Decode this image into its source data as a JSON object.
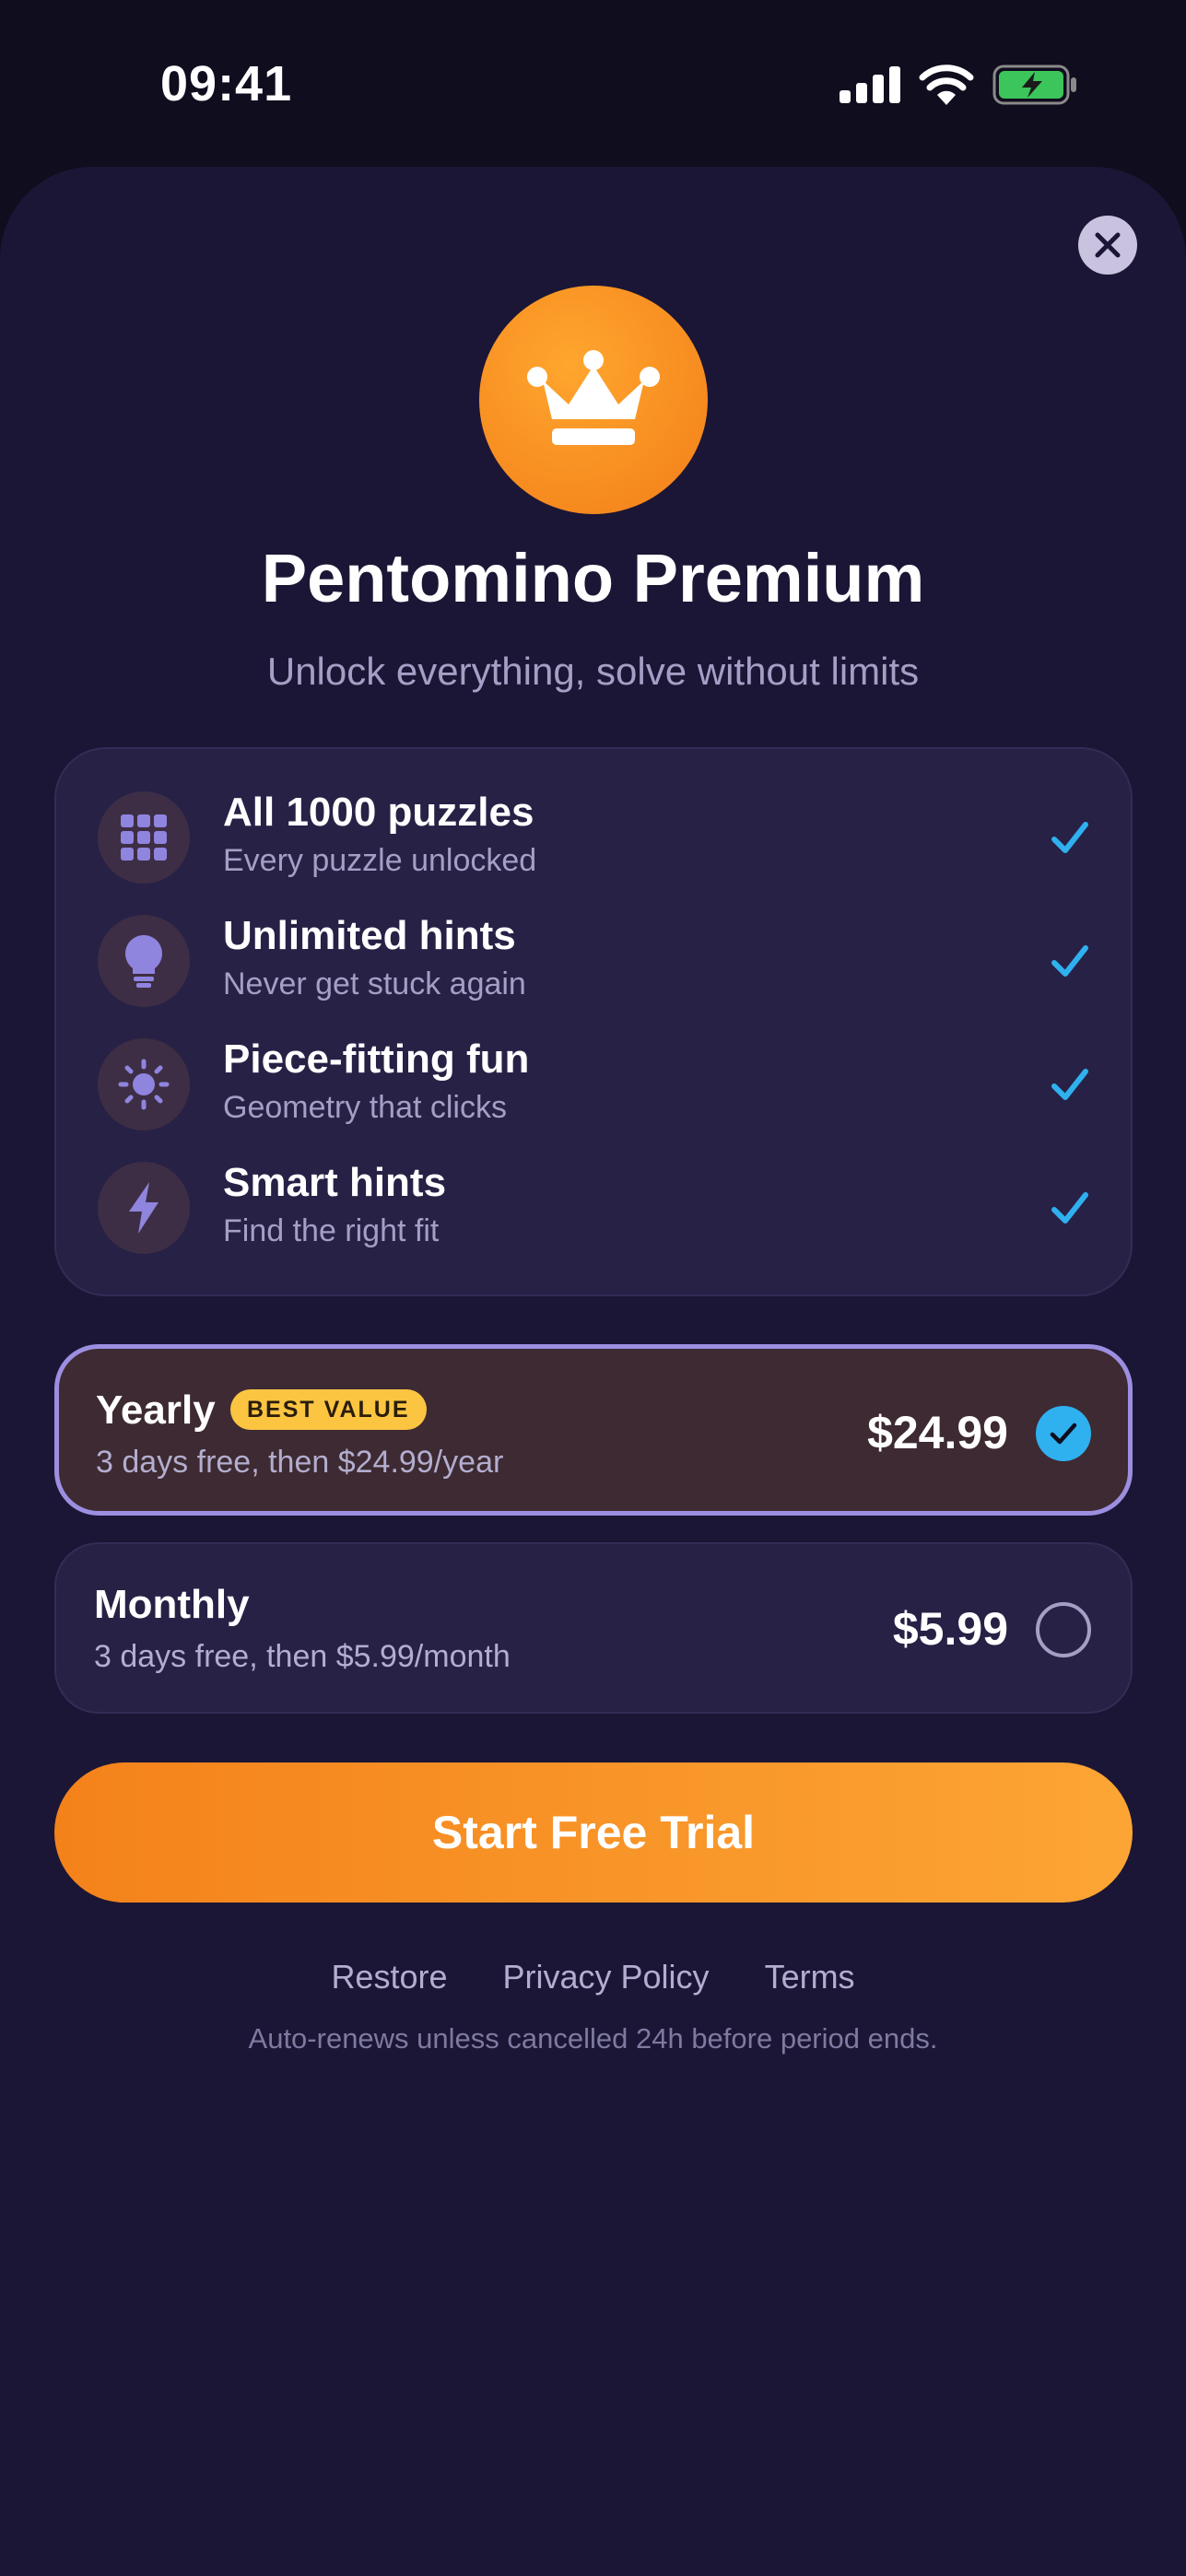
{
  "status_bar": {
    "time": "09:41",
    "icons": [
      "signal-icon",
      "wifi-icon",
      "battery-charging-icon"
    ]
  },
  "close_icon": "close-icon",
  "hero": {
    "icon": "crown-icon",
    "title": "Pentomino Premium",
    "subtitle": "Unlock everything, solve without limits"
  },
  "features": [
    {
      "icon": "grid-icon",
      "title": "All 1000 puzzles",
      "subtitle": "Every puzzle unlocked"
    },
    {
      "icon": "lightbulb-icon",
      "title": "Unlimited hints",
      "subtitle": "Never get stuck again"
    },
    {
      "icon": "sun-icon",
      "title": "Piece-fitting fun",
      "subtitle": "Geometry that clicks"
    },
    {
      "icon": "lightning-icon",
      "title": "Smart hints",
      "subtitle": "Find the right fit"
    }
  ],
  "plans": [
    {
      "name": "Yearly",
      "badge": "BEST VALUE",
      "description": "3 days free, then $24.99/year",
      "price": "$24.99",
      "selected": true
    },
    {
      "name": "Monthly",
      "description": "3 days free, then $5.99/month",
      "price": "$5.99",
      "selected": false
    }
  ],
  "cta": {
    "label": "Start Free Trial"
  },
  "footer": {
    "links": [
      "Restore",
      "Privacy Policy",
      "Terms"
    ],
    "note": "Auto-renews unless cancelled 24h before period ends."
  },
  "colors": {
    "background": "#0f0d1e",
    "sheet": "#1b1635",
    "card": "#272146",
    "accent_orange": "#f68a1f",
    "accent_blue": "#2fb0ef",
    "selected_border": "#9c8ee0",
    "badge": "#fbc542",
    "muted_text": "#a49fc5",
    "icon_purple": "#8f84de"
  }
}
